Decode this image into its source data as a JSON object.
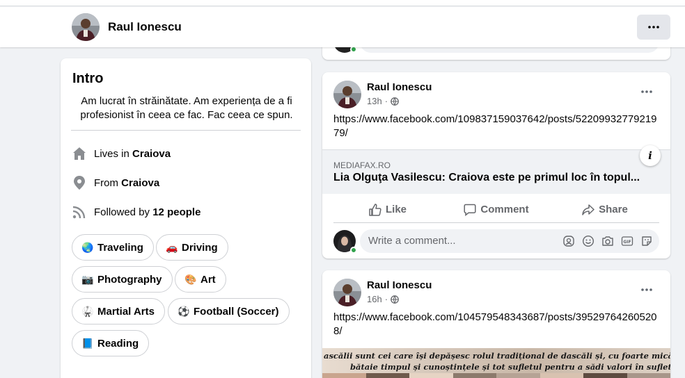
{
  "header": {
    "name": "Raul Ionescu",
    "more_label": "•••"
  },
  "intro": {
    "title": "Intro",
    "bio": "Am lucrat în străinătate. Am experiența de a fi profesionist în ceea ce fac. Fac ceea ce spun.",
    "lives_prefix": "Lives in ",
    "lives_city": "Craiova",
    "from_prefix": "From ",
    "from_city": "Craiova",
    "followed_prefix": "Followed by ",
    "followed_count": "12 people",
    "hobbies": [
      {
        "label": "Traveling",
        "emoji": "🌏"
      },
      {
        "label": "Driving",
        "emoji": "🚗"
      },
      {
        "label": "Photography",
        "emoji": "📷"
      },
      {
        "label": "Art",
        "emoji": "🎨"
      },
      {
        "label": "Martial Arts",
        "emoji": "🥋"
      },
      {
        "label": "Football (Soccer)",
        "emoji": "⚽"
      },
      {
        "label": "Reading",
        "emoji": "📘"
      }
    ]
  },
  "posts": [
    {
      "author": "Raul Ionescu",
      "time": "13h",
      "text": "https://www.facebook.com/109837159037642/posts/5220993277921979/",
      "link_domain": "MEDIAFAX.RO",
      "link_title": "Lia Olguţa Vasilescu: Craiova este pe primul loc în topul...",
      "info_label": "i"
    },
    {
      "author": "Raul Ionescu",
      "time": "16h",
      "text": "https://www.facebook.com/104579548343687/posts/395297642605208/",
      "banner_line1": "ascălii sunt cei care își depășesc rolul tradițional de dascăli și, cu foarte mică recompensă, își pu",
      "banner_line2": "bătaie timpul și cunoștințele și tot sufletul pentru a sădi valori în sufletul copiilor ..."
    }
  ],
  "actions": {
    "like": "Like",
    "comment": "Comment",
    "share": "Share"
  },
  "comment": {
    "placeholder": "Write a comment..."
  }
}
